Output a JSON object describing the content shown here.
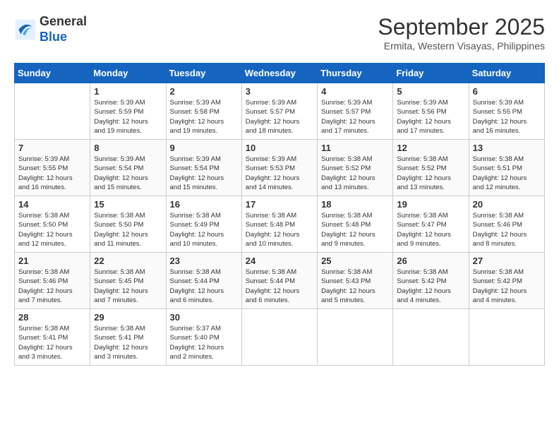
{
  "header": {
    "logo_line1": "General",
    "logo_line2": "Blue",
    "month": "September 2025",
    "location": "Ermita, Western Visayas, Philippines"
  },
  "days_of_week": [
    "Sunday",
    "Monday",
    "Tuesday",
    "Wednesday",
    "Thursday",
    "Friday",
    "Saturday"
  ],
  "weeks": [
    [
      {
        "day": "",
        "info": ""
      },
      {
        "day": "1",
        "info": "Sunrise: 5:39 AM\nSunset: 5:59 PM\nDaylight: 12 hours\nand 19 minutes."
      },
      {
        "day": "2",
        "info": "Sunrise: 5:39 AM\nSunset: 5:58 PM\nDaylight: 12 hours\nand 19 minutes."
      },
      {
        "day": "3",
        "info": "Sunrise: 5:39 AM\nSunset: 5:57 PM\nDaylight: 12 hours\nand 18 minutes."
      },
      {
        "day": "4",
        "info": "Sunrise: 5:39 AM\nSunset: 5:57 PM\nDaylight: 12 hours\nand 17 minutes."
      },
      {
        "day": "5",
        "info": "Sunrise: 5:39 AM\nSunset: 5:56 PM\nDaylight: 12 hours\nand 17 minutes."
      },
      {
        "day": "6",
        "info": "Sunrise: 5:39 AM\nSunset: 5:55 PM\nDaylight: 12 hours\nand 16 minutes."
      }
    ],
    [
      {
        "day": "7",
        "info": "Sunrise: 5:39 AM\nSunset: 5:55 PM\nDaylight: 12 hours\nand 16 minutes."
      },
      {
        "day": "8",
        "info": "Sunrise: 5:39 AM\nSunset: 5:54 PM\nDaylight: 12 hours\nand 15 minutes."
      },
      {
        "day": "9",
        "info": "Sunrise: 5:39 AM\nSunset: 5:54 PM\nDaylight: 12 hours\nand 15 minutes."
      },
      {
        "day": "10",
        "info": "Sunrise: 5:39 AM\nSunset: 5:53 PM\nDaylight: 12 hours\nand 14 minutes."
      },
      {
        "day": "11",
        "info": "Sunrise: 5:38 AM\nSunset: 5:52 PM\nDaylight: 12 hours\nand 13 minutes."
      },
      {
        "day": "12",
        "info": "Sunrise: 5:38 AM\nSunset: 5:52 PM\nDaylight: 12 hours\nand 13 minutes."
      },
      {
        "day": "13",
        "info": "Sunrise: 5:38 AM\nSunset: 5:51 PM\nDaylight: 12 hours\nand 12 minutes."
      }
    ],
    [
      {
        "day": "14",
        "info": "Sunrise: 5:38 AM\nSunset: 5:50 PM\nDaylight: 12 hours\nand 12 minutes."
      },
      {
        "day": "15",
        "info": "Sunrise: 5:38 AM\nSunset: 5:50 PM\nDaylight: 12 hours\nand 11 minutes."
      },
      {
        "day": "16",
        "info": "Sunrise: 5:38 AM\nSunset: 5:49 PM\nDaylight: 12 hours\nand 10 minutes."
      },
      {
        "day": "17",
        "info": "Sunrise: 5:38 AM\nSunset: 5:48 PM\nDaylight: 12 hours\nand 10 minutes."
      },
      {
        "day": "18",
        "info": "Sunrise: 5:38 AM\nSunset: 5:48 PM\nDaylight: 12 hours\nand 9 minutes."
      },
      {
        "day": "19",
        "info": "Sunrise: 5:38 AM\nSunset: 5:47 PM\nDaylight: 12 hours\nand 9 minutes."
      },
      {
        "day": "20",
        "info": "Sunrise: 5:38 AM\nSunset: 5:46 PM\nDaylight: 12 hours\nand 8 minutes."
      }
    ],
    [
      {
        "day": "21",
        "info": "Sunrise: 5:38 AM\nSunset: 5:46 PM\nDaylight: 12 hours\nand 7 minutes."
      },
      {
        "day": "22",
        "info": "Sunrise: 5:38 AM\nSunset: 5:45 PM\nDaylight: 12 hours\nand 7 minutes."
      },
      {
        "day": "23",
        "info": "Sunrise: 5:38 AM\nSunset: 5:44 PM\nDaylight: 12 hours\nand 6 minutes."
      },
      {
        "day": "24",
        "info": "Sunrise: 5:38 AM\nSunset: 5:44 PM\nDaylight: 12 hours\nand 6 minutes."
      },
      {
        "day": "25",
        "info": "Sunrise: 5:38 AM\nSunset: 5:43 PM\nDaylight: 12 hours\nand 5 minutes."
      },
      {
        "day": "26",
        "info": "Sunrise: 5:38 AM\nSunset: 5:42 PM\nDaylight: 12 hours\nand 4 minutes."
      },
      {
        "day": "27",
        "info": "Sunrise: 5:38 AM\nSunset: 5:42 PM\nDaylight: 12 hours\nand 4 minutes."
      }
    ],
    [
      {
        "day": "28",
        "info": "Sunrise: 5:38 AM\nSunset: 5:41 PM\nDaylight: 12 hours\nand 3 minutes."
      },
      {
        "day": "29",
        "info": "Sunrise: 5:38 AM\nSunset: 5:41 PM\nDaylight: 12 hours\nand 3 minutes."
      },
      {
        "day": "30",
        "info": "Sunrise: 5:37 AM\nSunset: 5:40 PM\nDaylight: 12 hours\nand 2 minutes."
      },
      {
        "day": "",
        "info": ""
      },
      {
        "day": "",
        "info": ""
      },
      {
        "day": "",
        "info": ""
      },
      {
        "day": "",
        "info": ""
      }
    ]
  ]
}
